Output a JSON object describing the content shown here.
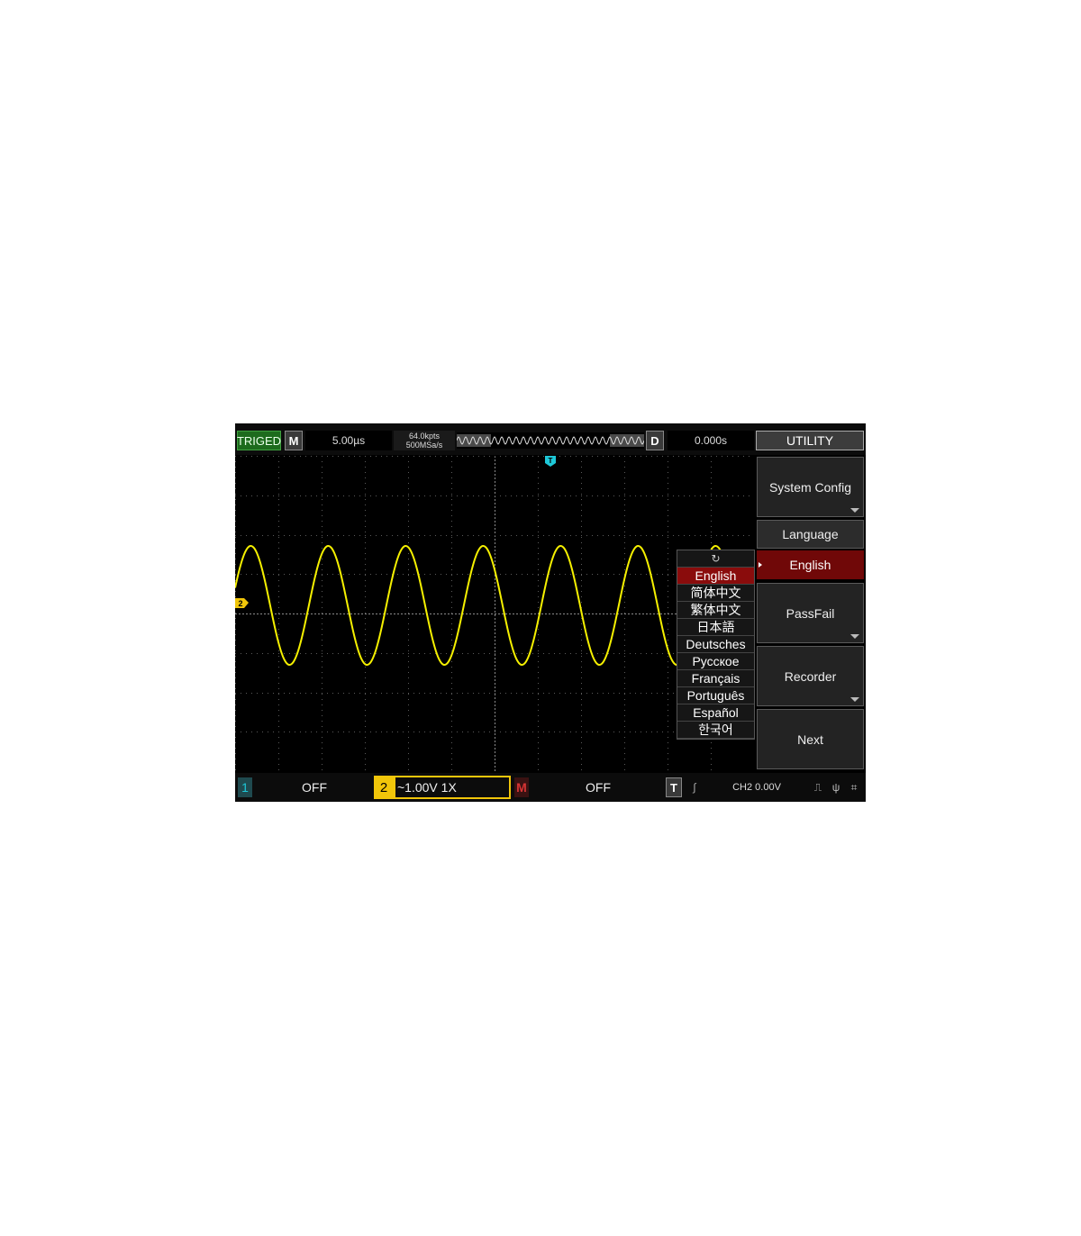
{
  "topbar": {
    "trigger_status": "TRIGED",
    "mode": "M",
    "timebase": "5.00µs",
    "memory_depth": "64.0kpts",
    "sample_rate": "500MSa/s",
    "delay_label": "D",
    "delay_value": "0.000s",
    "menu_title": "UTILITY"
  },
  "trigger_marker": "T",
  "channel_marker": "2",
  "menu": {
    "system_config": "System Config",
    "language_header": "Language",
    "language_selected": "English",
    "passfail": "PassFail",
    "recorder": "Recorder",
    "next": "Next"
  },
  "language_list": {
    "refresh_icon": "↻",
    "items": [
      "English",
      "简体中文",
      "繁体中文",
      "日本語",
      "Deutsches",
      "Русское",
      "Français",
      "Português",
      "Español",
      "한국어"
    ],
    "selected_index": 0
  },
  "bottombar": {
    "ch1_label": "1",
    "ch1_value": "OFF",
    "ch2_label": "2",
    "ch2_value": "~1.00V  1X",
    "math_label": "M",
    "math_value": "OFF",
    "trigger_label": "T",
    "trigger_edge_icon": "∫",
    "trigger_value": "CH2 0.00V",
    "usb_icon": "⎍",
    "usb_conn_icon": "ψ",
    "network_icon": "⌗"
  },
  "colors": {
    "waveform": "#f5f000",
    "trigger_marker": "#1ec8d8",
    "ch2_accent": "#f1c60a",
    "menu_selected": "#700808"
  }
}
